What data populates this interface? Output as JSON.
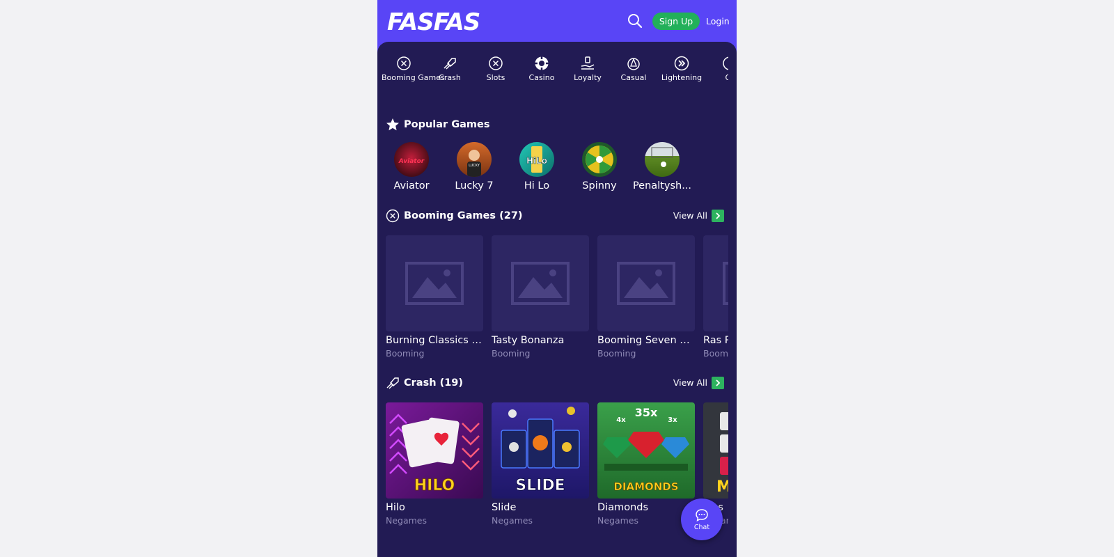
{
  "brand": {
    "logo_text": "FASFAS",
    "accent": "#5945f6",
    "panel": "#221b54",
    "green": "#22b05a"
  },
  "header": {
    "signup_label": "Sign Up",
    "login_label": "Login",
    "search_icon": "search-icon"
  },
  "categories": [
    {
      "label": "Booming Games",
      "icon": "booming-icon"
    },
    {
      "label": "Crash",
      "icon": "rocket-icon"
    },
    {
      "label": "Slots",
      "icon": "slots-icon"
    },
    {
      "label": "Casino",
      "icon": "casino-chip-icon"
    },
    {
      "label": "Loyalty",
      "icon": "loyalty-icon"
    },
    {
      "label": "Casual",
      "icon": "casual-icon"
    },
    {
      "label": "Lightening",
      "icon": "lightening-icon"
    },
    {
      "label": "Ot",
      "icon": "other-icon"
    }
  ],
  "popular": {
    "title": "Popular Games",
    "items": [
      {
        "name": "Aviator",
        "color": "#7a1a2a"
      },
      {
        "name": "Lucky 7",
        "color": "#b85c2a"
      },
      {
        "name": "Hi Lo",
        "color": "#1aa9a0"
      },
      {
        "name": "Spinny",
        "color": "#c9b21a"
      },
      {
        "name": "Penaltysh...",
        "color": "#6a8f2a"
      }
    ]
  },
  "sections": [
    {
      "title": "Booming Games (27)",
      "view_all": "View All",
      "games": [
        {
          "title": "Burning Classics 5...",
          "provider": "Booming",
          "placeholder": true
        },
        {
          "title": "Tasty Bonanza",
          "provider": "Booming",
          "placeholder": true
        },
        {
          "title": "Booming Seven D...",
          "provider": "Booming",
          "placeholder": true
        },
        {
          "title": "Ras R",
          "provider": "Boom",
          "placeholder": true
        }
      ]
    },
    {
      "title": "Crash (19)",
      "view_all": "View All",
      "games": [
        {
          "title": "Hilo",
          "provider": "Negames",
          "art": "HILO",
          "bg": "#5a0f73"
        },
        {
          "title": "Slide",
          "provider": "Negames",
          "art": "SLIDE",
          "bg": "#2a2290"
        },
        {
          "title": "Diamonds",
          "provider": "Negames",
          "art": "DIAMONDS",
          "bg": "#2f8a3a"
        },
        {
          "title": "Mes",
          "provider": "Negam",
          "art": "M",
          "bg": "#33363d"
        }
      ]
    }
  ],
  "chat": {
    "label": "Chat"
  }
}
